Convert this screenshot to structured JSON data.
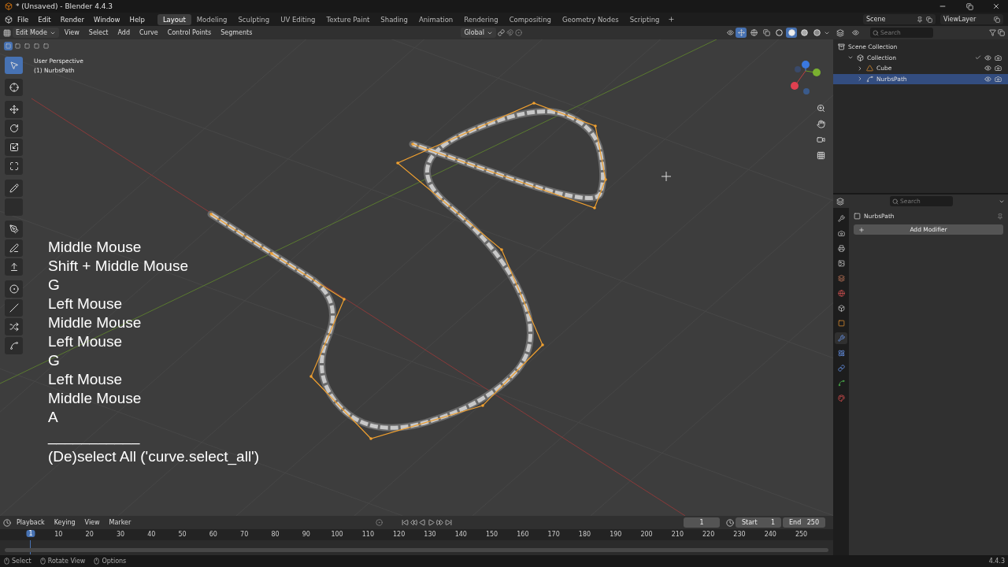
{
  "window": {
    "title": "* (Unsaved) - Blender 4.4.3"
  },
  "menus": [
    "File",
    "Edit",
    "Render",
    "Window",
    "Help"
  ],
  "workspaces": [
    {
      "label": "Layout",
      "selected": true
    },
    {
      "label": "Modeling",
      "selected": false
    },
    {
      "label": "Sculpting",
      "selected": false
    },
    {
      "label": "UV Editing",
      "selected": false
    },
    {
      "label": "Texture Paint",
      "selected": false
    },
    {
      "label": "Shading",
      "selected": false
    },
    {
      "label": "Animation",
      "selected": false
    },
    {
      "label": "Rendering",
      "selected": false
    },
    {
      "label": "Compositing",
      "selected": false
    },
    {
      "label": "Geometry Nodes",
      "selected": false
    },
    {
      "label": "Scripting",
      "selected": false
    }
  ],
  "scene": "Scene",
  "view_layer": "ViewLayer",
  "viewport": {
    "mode": "Edit Mode",
    "menus": [
      "View",
      "Select",
      "Add",
      "Curve",
      "Control Points",
      "Segments"
    ],
    "orientation": "Global",
    "select_modes": [
      {
        "selected": true
      },
      {
        "selected": false
      },
      {
        "selected": false
      },
      {
        "selected": false
      },
      {
        "selected": false
      }
    ],
    "shading_modes": [
      {
        "kind": "wireframe",
        "selected": false
      },
      {
        "kind": "solid",
        "selected": true
      },
      {
        "kind": "material",
        "selected": false
      },
      {
        "kind": "rendered",
        "selected": false
      }
    ],
    "overlay": [
      "User Perspective",
      "(1) NurbsPath"
    ],
    "tools": [
      {
        "kind": "select",
        "selected": true
      },
      {
        "kind": "cursor",
        "selected": false
      },
      {
        "kind": "move",
        "selected": false
      },
      {
        "kind": "rotate",
        "selected": false
      },
      {
        "kind": "scale",
        "selected": false
      },
      {
        "kind": "transform",
        "selected": false
      },
      {
        "kind": "annotate",
        "selected": false
      },
      {
        "kind": "measure",
        "selected": false
      },
      {
        "kind": "draw",
        "selected": false
      },
      {
        "kind": "pen",
        "selected": false
      },
      {
        "kind": "extrude",
        "selected": false
      },
      {
        "kind": "radius",
        "selected": false
      },
      {
        "kind": "tilt",
        "selected": false
      },
      {
        "kind": "randomize",
        "selected": false
      },
      {
        "kind": "curve",
        "selected": false
      }
    ],
    "keystrokes": [
      "Middle Mouse",
      "Shift + Middle Mouse",
      "G",
      "Left Mouse",
      "Middle Mouse",
      "Left Mouse",
      "G",
      "Left Mouse",
      "Middle Mouse",
      "A"
    ],
    "separator": "___________",
    "operator": "(De)select All ('curve.select_all')"
  },
  "outliner": {
    "search_placeholder": "Search",
    "items": [
      {
        "label": "Scene Collection",
        "kind": "scene",
        "children": [
          {
            "label": "Collection",
            "kind": "collection",
            "children": [
              {
                "label": "Cube",
                "kind": "mesh",
                "selected": false
              },
              {
                "label": "NurbsPath",
                "kind": "curve",
                "selected": true
              }
            ]
          }
        ]
      }
    ]
  },
  "properties": {
    "search_placeholder": "Search",
    "object": "NurbsPath",
    "add_modifier": "Add Modifier",
    "tabs": [
      {
        "kind": "tool",
        "selected": false
      },
      {
        "kind": "render",
        "selected": false
      },
      {
        "kind": "output",
        "selected": false
      },
      {
        "kind": "view_layer",
        "selected": false
      },
      {
        "kind": "scene",
        "selected": false
      },
      {
        "kind": "world",
        "selected": false
      },
      {
        "kind": "collection",
        "selected": false
      },
      {
        "kind": "object",
        "selected": false
      },
      {
        "kind": "modifiers",
        "selected": true
      },
      {
        "kind": "physics",
        "selected": false
      },
      {
        "kind": "constraints",
        "selected": false
      },
      {
        "kind": "data",
        "selected": false
      },
      {
        "kind": "material",
        "selected": false
      }
    ]
  },
  "timeline": {
    "menus": [
      "Playback",
      "Keying",
      "View",
      "Marker"
    ],
    "current_frame": "1",
    "start_label": "Start",
    "start": "1",
    "end_label": "End",
    "end": "250",
    "ticks": [
      "1",
      "10",
      "20",
      "30",
      "40",
      "50",
      "60",
      "70",
      "80",
      "90",
      "100",
      "110",
      "120",
      "130",
      "140",
      "150",
      "160",
      "170",
      "180",
      "190",
      "200",
      "210",
      "220",
      "230",
      "240",
      "250"
    ]
  },
  "status": {
    "hints": [
      "Select",
      "Rotate View",
      "Options"
    ],
    "version": "4.4.3"
  }
}
